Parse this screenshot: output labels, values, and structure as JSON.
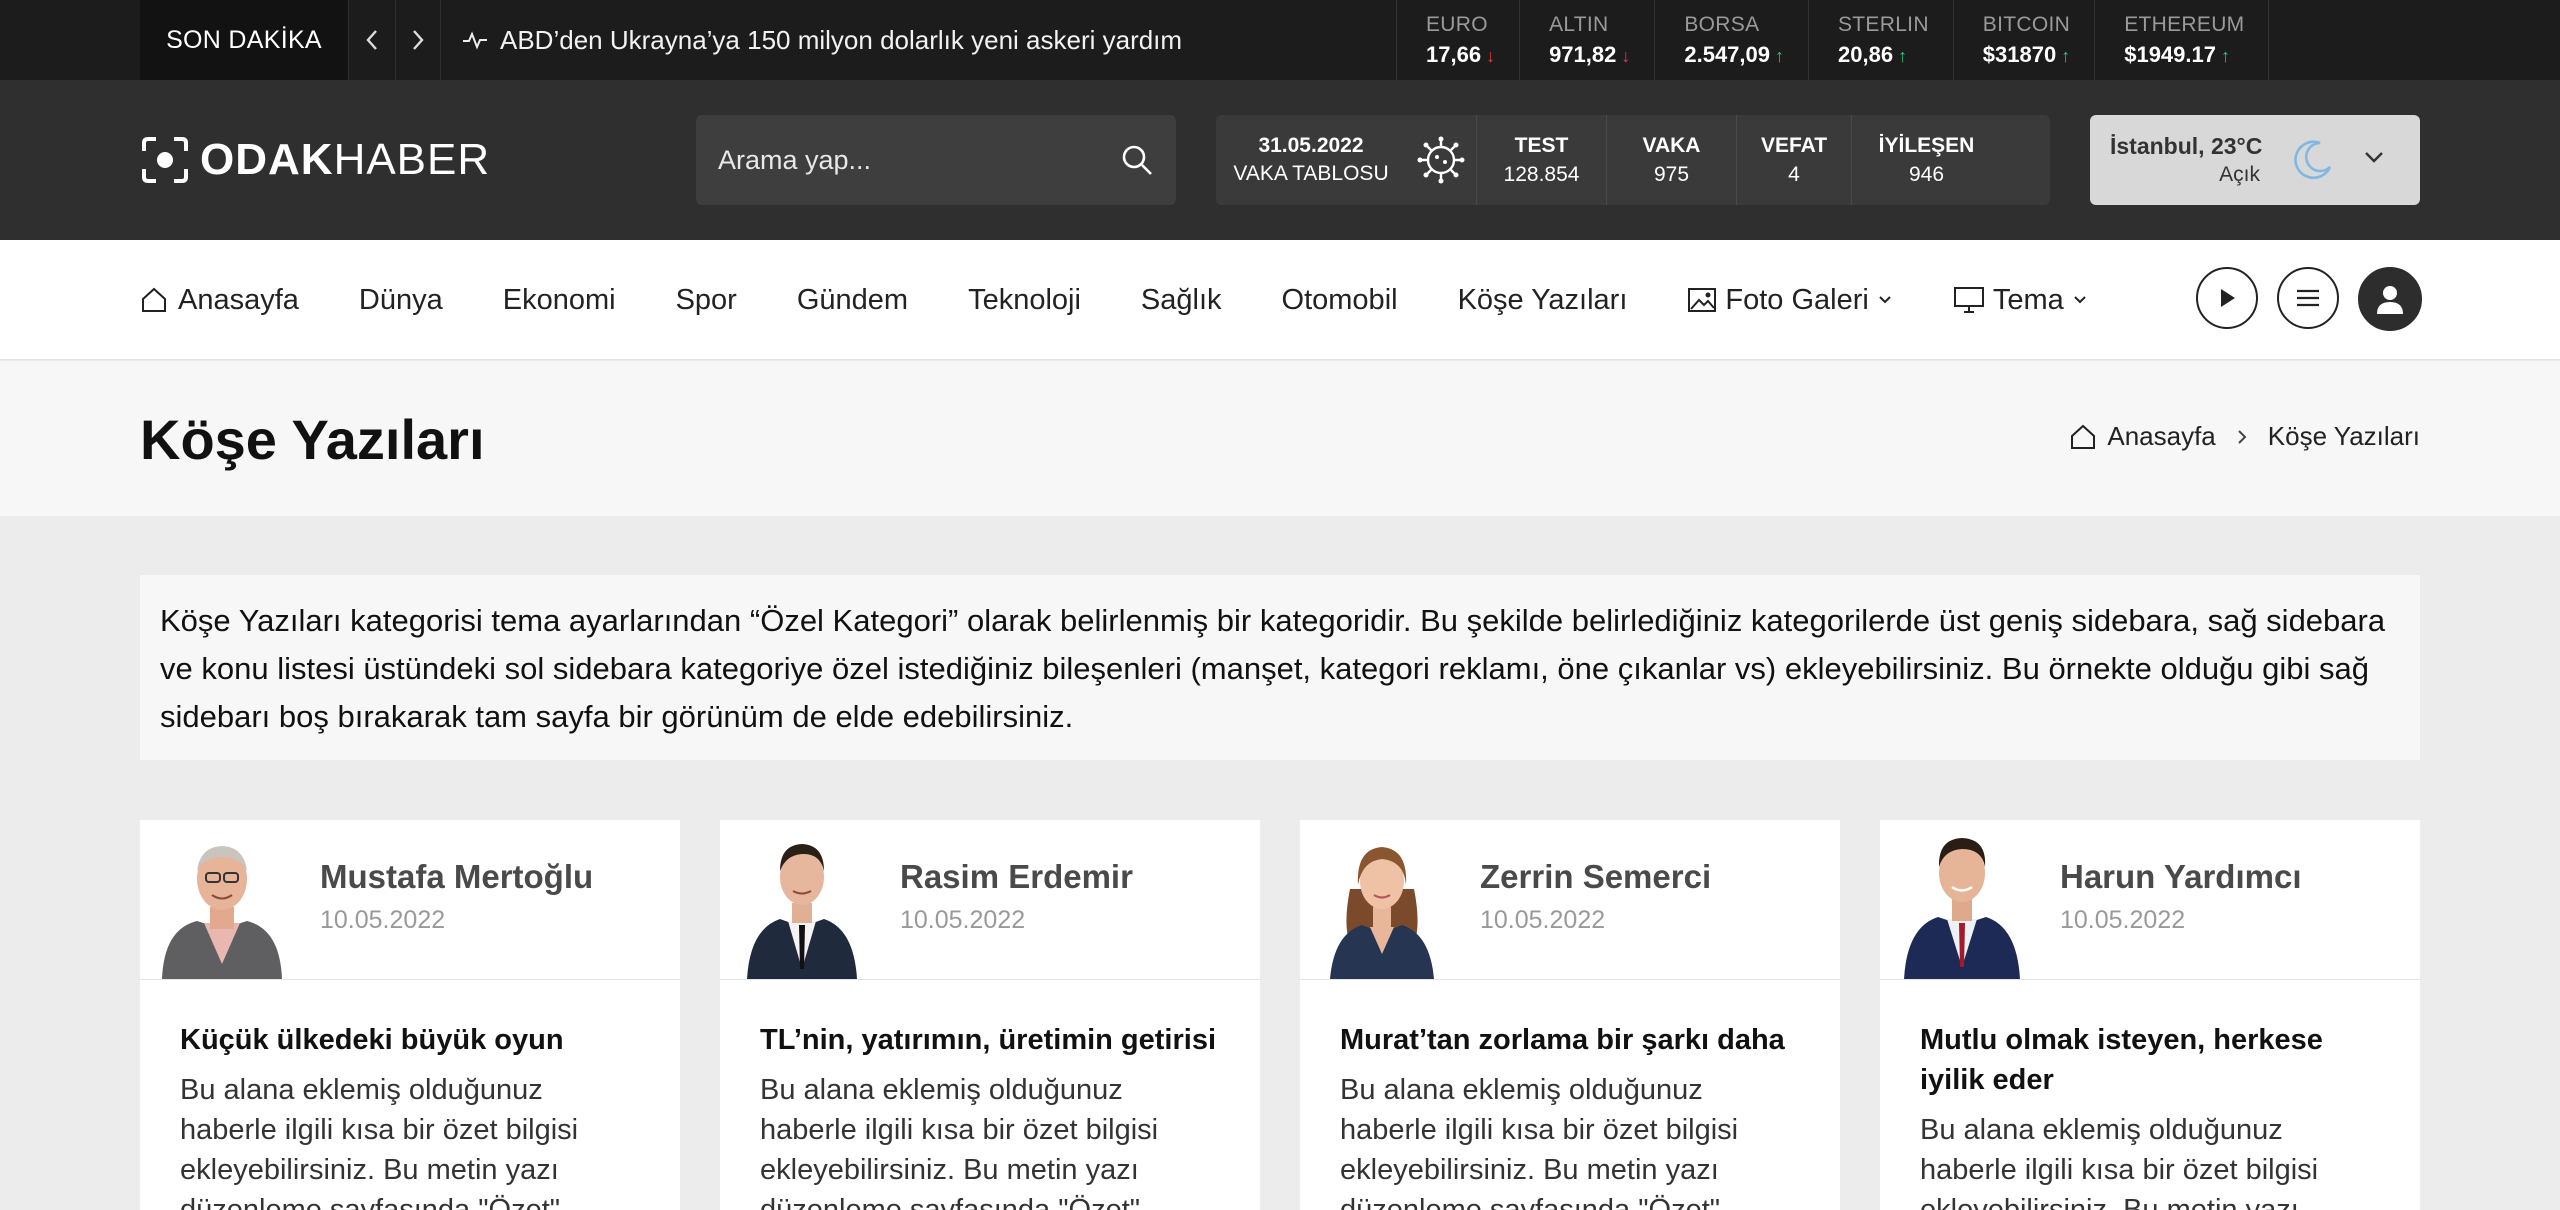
{
  "ticker": {
    "label": "SON DAKİKA",
    "headline": "ABD’den Ukrayna’ya 150 milyon dolarlık yeni askeri yardım"
  },
  "markets": [
    {
      "name": "EURO",
      "value": "17,66",
      "trend": "down"
    },
    {
      "name": "ALTIN",
      "value": "971,82",
      "trend": "down"
    },
    {
      "name": "BORSA",
      "value": "2.547,09",
      "trend": "up"
    },
    {
      "name": "STERLIN",
      "value": "20,86",
      "trend": "up"
    },
    {
      "name": "BITCOIN",
      "value": "$31870",
      "trend": "up"
    },
    {
      "name": "ETHEREUM",
      "value": "$1949.17",
      "trend": "up"
    }
  ],
  "logo": {
    "bold": "ODAK",
    "light": "HABER"
  },
  "search": {
    "placeholder": "Arama yap..."
  },
  "covid": {
    "date": "31.05.2022",
    "label": "VAKA TABLOSU",
    "stats": [
      {
        "label": "TEST",
        "value": "128.854"
      },
      {
        "label": "VAKA",
        "value": "975"
      },
      {
        "label": "VEFAT",
        "value": "4"
      },
      {
        "label": "İYİLEŞEN",
        "value": "946"
      }
    ]
  },
  "weather": {
    "city": "İstanbul, 23°C",
    "desc": "Açık"
  },
  "nav": {
    "items": [
      "Anasayfa",
      "Dünya",
      "Ekonomi",
      "Spor",
      "Gündem",
      "Teknoloji",
      "Sağlık",
      "Otomobil",
      "Köşe Yazıları",
      "Foto Galeri",
      "Tema"
    ]
  },
  "page": {
    "title": "Köşe Yazıları",
    "breadcrumb": [
      "Anasayfa",
      "Köşe Yazıları"
    ],
    "description": "Köşe Yazıları kategorisi tema ayarlarından “Özel Kategori” olarak belirlenmiş bir kategoridir. Bu şekilde belirlediğiniz kategorilerde üst geniş sidebara, sağ sidebara ve konu listesi üstündeki sol sidebara kategoriye özel istediğiniz bileşenleri (manşet, kategori reklamı, öne çıkanlar vs) ekleyebilirsiniz. Bu örnekte olduğu gibi sağ sidebarı boş bırakarak tam sayfa bir görünüm de elde edebilirsiniz."
  },
  "cards": [
    {
      "author": "Mustafa Mertoğlu",
      "date": "10.05.2022",
      "title": "Küçük ülkedeki büyük oyun",
      "text": "Bu alana eklemiş olduğunuz haberle ilgili kısa bir özet bilgisi ekleyebilirsiniz. Bu metin yazı düzenleme sayfasında \"Özet\""
    },
    {
      "author": "Rasim Erdemir",
      "date": "10.05.2022",
      "title": "TL’nin, yatırımın, üretimin getirisi",
      "text": "Bu alana eklemiş olduğunuz haberle ilgili kısa bir özet bilgisi ekleyebilirsiniz. Bu metin yazı düzenleme sayfasında \"Özet\""
    },
    {
      "author": "Zerrin Semerci",
      "date": "10.05.2022",
      "title": "Murat’tan zorlama bir şarkı daha",
      "text": "Bu alana eklemiş olduğunuz haberle ilgili kısa bir özet bilgisi ekleyebilirsiniz. Bu metin yazı düzenleme sayfasında \"Özet\""
    },
    {
      "author": "Harun Yardımcı",
      "date": "10.05.2022",
      "title": "Mutlu olmak isteyen, herkese iyilik eder",
      "text": "Bu alana eklemiş olduğunuz haberle ilgili kısa bir özet bilgisi ekleyebilirsiniz. Bu metin yazı düzenleme sayfasında \"Özet\""
    }
  ],
  "colors": {
    "down": "#e53b3b",
    "up": "#2cc470",
    "header": "#2f2f2f",
    "ticker": "#1c1c1c",
    "moon": "#7fb9e3"
  }
}
